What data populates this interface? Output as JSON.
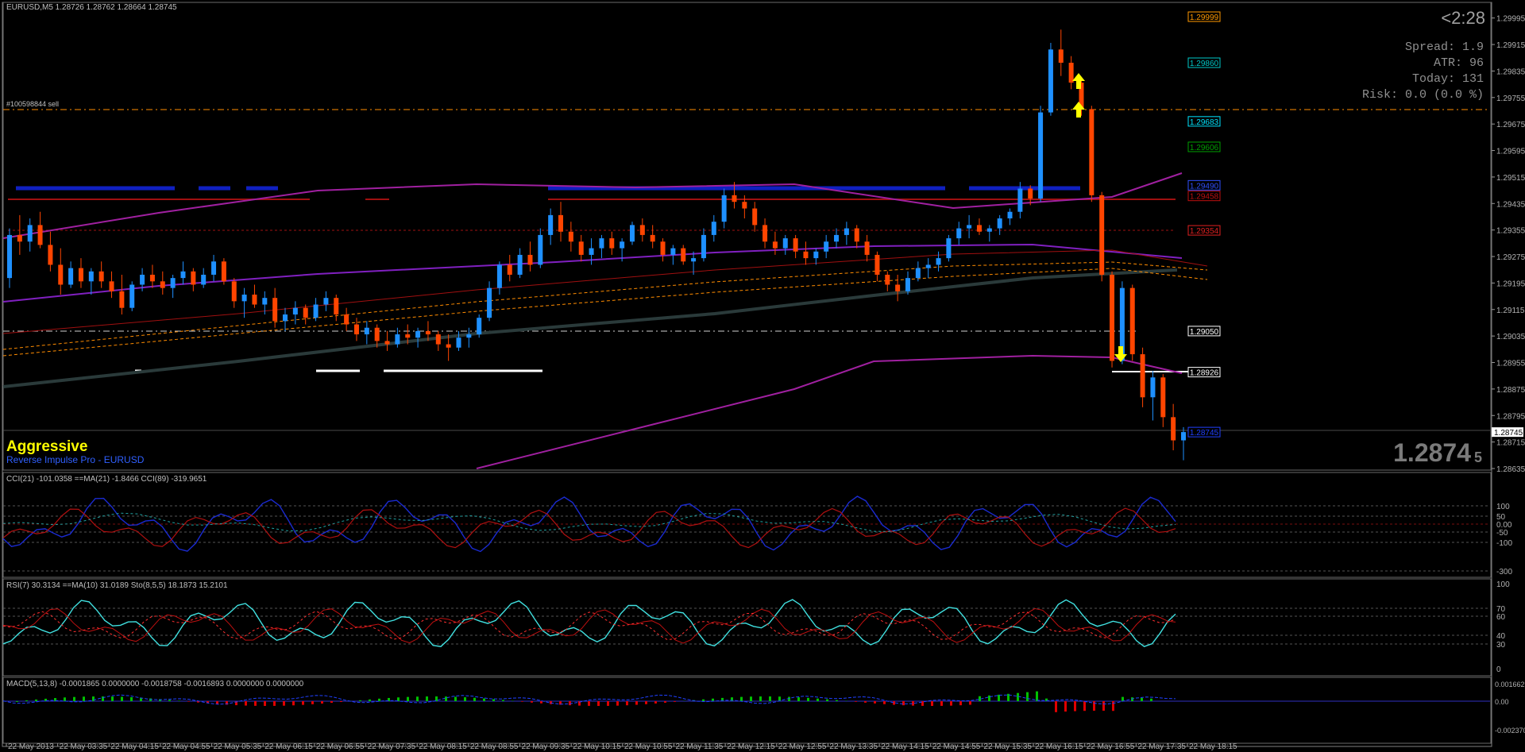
{
  "header": {
    "main": "EURUSD,M5  1.28726 1.28762 1.28664 1.28745",
    "order": "#100598844 sell",
    "cci": "CCI(21) -101.0358  ==MA(21) -1.8466  CCI(89) -319.9651",
    "rsi": "RSI(7) 30.3134  ==MA(10) 31.0189  Sto(8,5,5) 18.1873 15.2101",
    "macd": "MACD(5,13,8) -0.0001865 0.0000000 -0.0018758 -0.0016893 0.0000000 0.0000000"
  },
  "stats": {
    "timer": "<2:28",
    "spread": "Spread: 1.9",
    "atr": "ATR: 96",
    "today": "Today: 131",
    "risk": "Risk: 0.0 (0.0 %)"
  },
  "signal": {
    "mode": "Aggressive",
    "system": "Reverse Impulse Pro - EURUSD"
  },
  "big_price": {
    "main": "1.2874",
    "pip": "5"
  },
  "price_axis": [
    "1.29995",
    "1.29915",
    "1.29835",
    "1.29755",
    "1.29675",
    "1.29595",
    "1.29515",
    "1.29435",
    "1.29355",
    "1.29275",
    "1.29195",
    "1.29115",
    "1.29035",
    "1.28955",
    "1.28875",
    "1.28795",
    "1.28715",
    "1.28635"
  ],
  "level_tags": [
    {
      "text": "1.29999",
      "price": 1.29999,
      "color": "#ff9900"
    },
    {
      "text": "1.29860",
      "price": 1.2986,
      "color": "#00c8c8"
    },
    {
      "text": "1.29683",
      "price": 1.29683,
      "color": "#00e5ff"
    },
    {
      "text": "1.29606",
      "price": 1.29606,
      "color": "#00a000"
    },
    {
      "text": "1.29490",
      "price": 1.2949,
      "color": "#3050ff"
    },
    {
      "text": "1.29458",
      "price": 1.29458,
      "color": "#c01010"
    },
    {
      "text": "1.29354",
      "price": 1.29354,
      "color": "#e02020"
    },
    {
      "text": "1.29050",
      "price": 1.2905,
      "color": "#ffffff"
    },
    {
      "text": "1.28926",
      "price": 1.28926,
      "color": "#ffffff"
    },
    {
      "text": "1.28745",
      "price": 1.28745,
      "color": "#2040ff"
    }
  ],
  "current_price_tag": "1.28745",
  "cci_axis": [
    "100",
    "50",
    "0.00",
    "-50",
    "-100",
    "-300"
  ],
  "rsi_axis": [
    "100",
    "70",
    "60",
    "40",
    "30",
    "0"
  ],
  "macd_axis": [
    "0.001662",
    "0.00",
    "-0.002370"
  ],
  "time_axis": [
    "22 May 2013",
    "22 May 03:35",
    "22 May 04:15",
    "22 May 04:55",
    "22 May 05:35",
    "22 May 06:15",
    "22 May 06:55",
    "22 May 07:35",
    "22 May 08:15",
    "22 May 08:55",
    "22 May 09:35",
    "22 May 10:15",
    "22 May 10:55",
    "22 May 11:35",
    "22 May 12:15",
    "22 May 12:55",
    "22 May 13:35",
    "22 May 14:15",
    "22 May 14:55",
    "22 May 15:35",
    "22 May 16:15",
    "22 May 16:55",
    "22 May 17:35",
    "22 May 18:15"
  ],
  "colors": {
    "bull": "#1e90ff",
    "bear": "#ff4500",
    "bg": "#000000",
    "grid": "#3a3a3a",
    "arrow": "#ffff00"
  },
  "chart_data": {
    "type": "candlestick",
    "symbol": "EURUSD",
    "timeframe": "M5",
    "ylim": [
      1.28635,
      1.30035
    ],
    "candles": [
      [
        1.2921,
        1.2936,
        1.2918,
        1.2934
      ],
      [
        1.2934,
        1.294,
        1.2928,
        1.2932
      ],
      [
        1.2932,
        1.2939,
        1.2929,
        1.2937
      ],
      [
        1.2937,
        1.2941,
        1.293,
        1.2931
      ],
      [
        1.2931,
        1.2935,
        1.2923,
        1.2925
      ],
      [
        1.2925,
        1.293,
        1.2916,
        1.2919
      ],
      [
        1.2919,
        1.2926,
        1.2918,
        1.2924
      ],
      [
        1.2924,
        1.2927,
        1.2918,
        1.292
      ],
      [
        1.292,
        1.2924,
        1.2916,
        1.2923
      ],
      [
        1.2923,
        1.2926,
        1.2918,
        1.292
      ],
      [
        1.292,
        1.2923,
        1.2915,
        1.2917
      ],
      [
        1.2917,
        1.2922,
        1.291,
        1.2912
      ],
      [
        1.2912,
        1.292,
        1.2911,
        1.2919
      ],
      [
        1.2919,
        1.2924,
        1.2917,
        1.2922
      ],
      [
        1.2922,
        1.2925,
        1.2918,
        1.292
      ],
      [
        1.292,
        1.2923,
        1.2916,
        1.2918
      ],
      [
        1.2918,
        1.2922,
        1.2915,
        1.2921
      ],
      [
        1.2921,
        1.2926,
        1.2919,
        1.2923
      ],
      [
        1.2923,
        1.2924,
        1.2917,
        1.2919
      ],
      [
        1.2919,
        1.2924,
        1.2918,
        1.2922
      ],
      [
        1.2922,
        1.2928,
        1.292,
        1.2926
      ],
      [
        1.2926,
        1.2927,
        1.2919,
        1.292
      ],
      [
        1.292,
        1.2921,
        1.2912,
        1.2914
      ],
      [
        1.2914,
        1.2918,
        1.2909,
        1.2916
      ],
      [
        1.2916,
        1.2919,
        1.2912,
        1.2913
      ],
      [
        1.2913,
        1.2917,
        1.291,
        1.2915
      ],
      [
        1.2915,
        1.2918,
        1.2906,
        1.2908
      ],
      [
        1.2908,
        1.2912,
        1.2905,
        1.291
      ],
      [
        1.291,
        1.2914,
        1.2907,
        1.2912
      ],
      [
        1.2912,
        1.2913,
        1.2907,
        1.2909
      ],
      [
        1.2909,
        1.2915,
        1.2908,
        1.2913
      ],
      [
        1.2913,
        1.2917,
        1.2911,
        1.2915
      ],
      [
        1.2915,
        1.2916,
        1.2908,
        1.291
      ],
      [
        1.291,
        1.2912,
        1.2905,
        1.2907
      ],
      [
        1.2907,
        1.2909,
        1.2902,
        1.2904
      ],
      [
        1.2904,
        1.2908,
        1.2901,
        1.2906
      ],
      [
        1.2906,
        1.2907,
        1.29,
        1.2902
      ],
      [
        1.2902,
        1.2905,
        1.2899,
        1.2901
      ],
      [
        1.2901,
        1.2906,
        1.29,
        1.2904
      ],
      [
        1.2904,
        1.2907,
        1.2901,
        1.2903
      ],
      [
        1.2903,
        1.2906,
        1.29,
        1.2905
      ],
      [
        1.2905,
        1.2908,
        1.2902,
        1.2904
      ],
      [
        1.2904,
        1.2905,
        1.2899,
        1.2901
      ],
      [
        1.2901,
        1.2904,
        1.2896,
        1.29
      ],
      [
        1.29,
        1.2905,
        1.2899,
        1.2903
      ],
      [
        1.2903,
        1.2906,
        1.29,
        1.2904
      ],
      [
        1.2904,
        1.291,
        1.2903,
        1.2909
      ],
      [
        1.2909,
        1.292,
        1.2908,
        1.2918
      ],
      [
        1.2918,
        1.2926,
        1.2916,
        1.2925
      ],
      [
        1.2925,
        1.2928,
        1.292,
        1.2922
      ],
      [
        1.2922,
        1.293,
        1.2921,
        1.2928
      ],
      [
        1.2928,
        1.2932,
        1.2923,
        1.2925
      ],
      [
        1.2925,
        1.2936,
        1.2924,
        1.2934
      ],
      [
        1.2934,
        1.2942,
        1.2931,
        1.294
      ],
      [
        1.294,
        1.2944,
        1.2932,
        1.2935
      ],
      [
        1.2935,
        1.2938,
        1.2929,
        1.2932
      ],
      [
        1.2932,
        1.2934,
        1.2926,
        1.2928
      ],
      [
        1.2928,
        1.2933,
        1.2925,
        1.293
      ],
      [
        1.293,
        1.2934,
        1.2927,
        1.2933
      ],
      [
        1.2933,
        1.2935,
        1.2928,
        1.293
      ],
      [
        1.293,
        1.2933,
        1.2926,
        1.2932
      ],
      [
        1.2932,
        1.2938,
        1.2931,
        1.2937
      ],
      [
        1.2937,
        1.2939,
        1.2932,
        1.2934
      ],
      [
        1.2934,
        1.2937,
        1.293,
        1.2932
      ],
      [
        1.2932,
        1.2933,
        1.2926,
        1.2928
      ],
      [
        1.2928,
        1.2931,
        1.2925,
        1.293
      ],
      [
        1.293,
        1.2931,
        1.2925,
        1.2926
      ],
      [
        1.2926,
        1.2929,
        1.2922,
        1.2927
      ],
      [
        1.2927,
        1.2936,
        1.2926,
        1.2934
      ],
      [
        1.2934,
        1.294,
        1.2932,
        1.2938
      ],
      [
        1.2938,
        1.2948,
        1.2936,
        1.2946
      ],
      [
        1.2946,
        1.295,
        1.2942,
        1.2944
      ],
      [
        1.2944,
        1.2946,
        1.2939,
        1.2942
      ],
      [
        1.2942,
        1.2944,
        1.2935,
        1.2937
      ],
      [
        1.2937,
        1.2939,
        1.293,
        1.2932
      ],
      [
        1.2932,
        1.2935,
        1.2928,
        1.293
      ],
      [
        1.293,
        1.2934,
        1.2928,
        1.2933
      ],
      [
        1.2933,
        1.2934,
        1.2927,
        1.2929
      ],
      [
        1.2929,
        1.2932,
        1.2925,
        1.2927
      ],
      [
        1.2927,
        1.293,
        1.2925,
        1.2929
      ],
      [
        1.2929,
        1.2934,
        1.2927,
        1.2932
      ],
      [
        1.2932,
        1.2936,
        1.293,
        1.2934
      ],
      [
        1.2934,
        1.2938,
        1.2931,
        1.2936
      ],
      [
        1.2936,
        1.2937,
        1.293,
        1.2932
      ],
      [
        1.2932,
        1.2934,
        1.2926,
        1.2928
      ],
      [
        1.2928,
        1.2929,
        1.292,
        1.2922
      ],
      [
        1.2922,
        1.2923,
        1.2917,
        1.2919
      ],
      [
        1.2919,
        1.2922,
        1.2914,
        1.2917
      ],
      [
        1.2917,
        1.2923,
        1.2916,
        1.2921
      ],
      [
        1.2921,
        1.2926,
        1.292,
        1.2924
      ],
      [
        1.2924,
        1.2927,
        1.2921,
        1.2925
      ],
      [
        1.2925,
        1.2929,
        1.2923,
        1.2927
      ],
      [
        1.2927,
        1.2934,
        1.2926,
        1.2933
      ],
      [
        1.2933,
        1.2938,
        1.2931,
        1.2936
      ],
      [
        1.2936,
        1.294,
        1.2933,
        1.2937
      ],
      [
        1.2937,
        1.2939,
        1.2934,
        1.2935
      ],
      [
        1.2935,
        1.2937,
        1.2932,
        1.2936
      ],
      [
        1.2936,
        1.294,
        1.2934,
        1.2939
      ],
      [
        1.2939,
        1.2942,
        1.2937,
        1.2941
      ],
      [
        1.2941,
        1.295,
        1.2939,
        1.2948
      ],
      [
        1.2948,
        1.2949,
        1.2943,
        1.2945
      ],
      [
        1.2945,
        1.2973,
        1.2944,
        1.2971
      ],
      [
        1.2971,
        1.2992,
        1.297,
        1.299
      ],
      [
        1.299,
        1.2996,
        1.2982,
        1.2986
      ],
      [
        1.2986,
        1.2988,
        1.2978,
        1.298
      ],
      [
        1.298,
        1.2981,
        1.297,
        1.2972
      ],
      [
        1.2972,
        1.2973,
        1.2944,
        1.2946
      ],
      [
        1.2946,
        1.2947,
        1.292,
        1.2922
      ],
      [
        1.2922,
        1.2923,
        1.2894,
        1.2896
      ],
      [
        1.2896,
        1.292,
        1.2895,
        1.2918
      ],
      [
        1.2918,
        1.2919,
        1.2896,
        1.2898
      ],
      [
        1.2898,
        1.29,
        1.2882,
        1.2885
      ],
      [
        1.2885,
        1.2893,
        1.2878,
        1.2891
      ],
      [
        1.2891,
        1.2892,
        1.2876,
        1.2879
      ],
      [
        1.2879,
        1.2883,
        1.2869,
        1.2872
      ],
      [
        1.2872,
        1.2876,
        1.2866,
        1.28745
      ]
    ]
  }
}
